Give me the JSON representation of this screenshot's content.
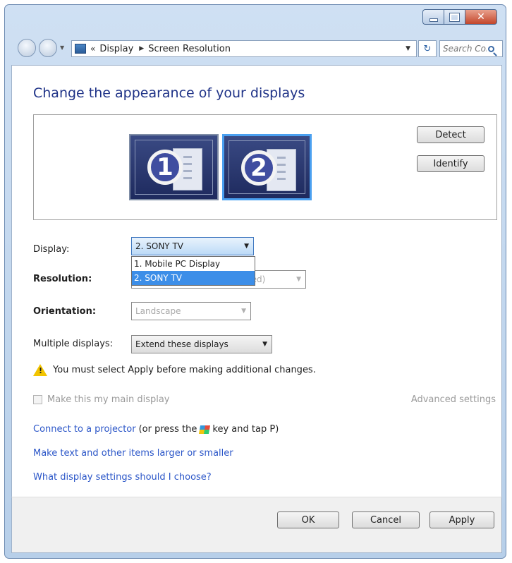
{
  "address_bar": {
    "breadcrumb": [
      "Display",
      "Screen Resolution"
    ],
    "chevron": "«"
  },
  "search": {
    "placeholder": "Search Con..."
  },
  "main": {
    "title": "Change the appearance of your displays",
    "monitors": [
      {
        "number": "1"
      },
      {
        "number": "2"
      }
    ],
    "detect_label": "Detect",
    "identify_label": "Identify",
    "display_label": "Display:",
    "display_value": "2. SONY TV",
    "display_options": [
      "1. Mobile PC Display",
      "2. SONY TV"
    ],
    "resolution_label": "Resolution:",
    "resolution_value": "ded)",
    "orientation_label": "Orientation:",
    "orientation_value": "Landscape",
    "multiple_label": "Multiple displays:",
    "multiple_value": "Extend these displays",
    "warning": "You must select Apply before making additional changes.",
    "main_display_label": "Make this my main display",
    "advanced_settings": "Advanced settings",
    "link_projector": "Connect to a projector",
    "projector_hint_pre": "(or press the",
    "projector_hint_post": "key and tap P)",
    "link_text_size": "Make text and other items larger or smaller",
    "link_help": "What display settings should I choose?"
  },
  "footer": {
    "ok_label": "OK",
    "cancel_label": "Cancel",
    "apply_label": "Apply"
  }
}
